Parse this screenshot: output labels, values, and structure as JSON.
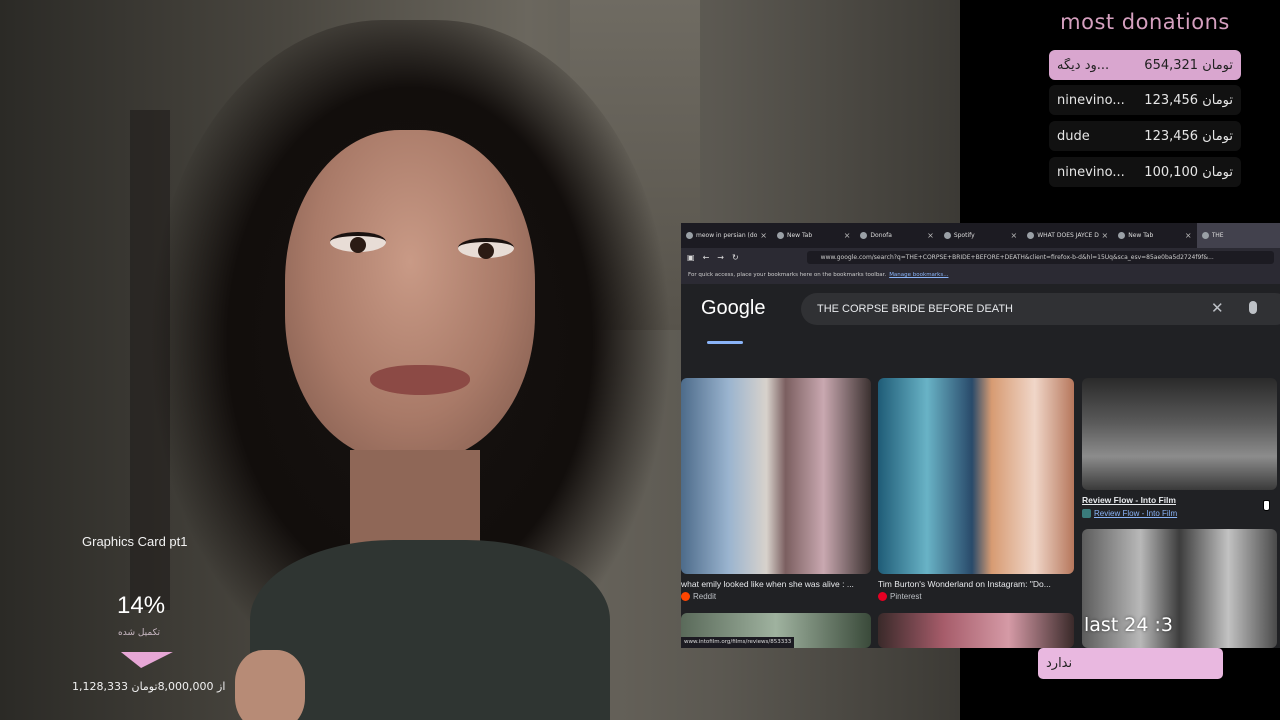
{
  "donations": {
    "title": "most donations",
    "rows": [
      {
        "name": "ود دیگه...",
        "amount": "654,321 تومان"
      },
      {
        "name": "ninevino...",
        "amount": "123,456 تومان"
      },
      {
        "name": "dude",
        "amount": "123,456 تومان"
      },
      {
        "name": "ninevino...",
        "amount": "100,100 تومان"
      }
    ]
  },
  "goal": {
    "title": "Graphics Card pt1",
    "percent": "14%",
    "percent_value": 14,
    "subtitle": "تکمیل شده",
    "amount": "1,128,333 از 8,000,000تومان"
  },
  "browser": {
    "tabs": [
      {
        "label": "meow in persian (dor...",
        "close": "×"
      },
      {
        "label": "New Tab",
        "close": "×"
      },
      {
        "label": "Donofa",
        "close": "×"
      },
      {
        "label": "Spotify",
        "close": "×"
      },
      {
        "label": "WHAT DOES JAYCE D...",
        "close": "×"
      },
      {
        "label": "New Tab",
        "close": "×"
      },
      {
        "label": "THE",
        "close": ""
      }
    ],
    "url": "www.google.com/search?q=THE+CORPSE+BRIDE+BEFORE+DEATH&client=firefox-b-d&hl=15Uq&sca_esv=85ae0ba5d2724f9f&...",
    "bookmarks_text": "For quick access, place your bookmarks here on the bookmarks toolbar.",
    "bookmarks_link": "Manage bookmarks...",
    "google_logo": "Google",
    "search_query": "THE CORPSE BRIDE BEFORE DEATH",
    "results": [
      {
        "title": "what emily looked like when she was alive : ...",
        "source": "Reddit"
      },
      {
        "title": "Tim Burton's Wonderland on Instagram: \"Do...",
        "source": "Pinterest"
      },
      {
        "title": "Review Flow - Into Film",
        "source": "Review Flow - Into Film"
      }
    ],
    "status_url": "www.intofilm.org/films/reviews/853333"
  },
  "overlay": {
    "timer": "last 24 :3",
    "status": "ندارد"
  },
  "colors": {
    "accent_pink": "#e9b8e0",
    "donation_title": "#d5a0bf"
  }
}
